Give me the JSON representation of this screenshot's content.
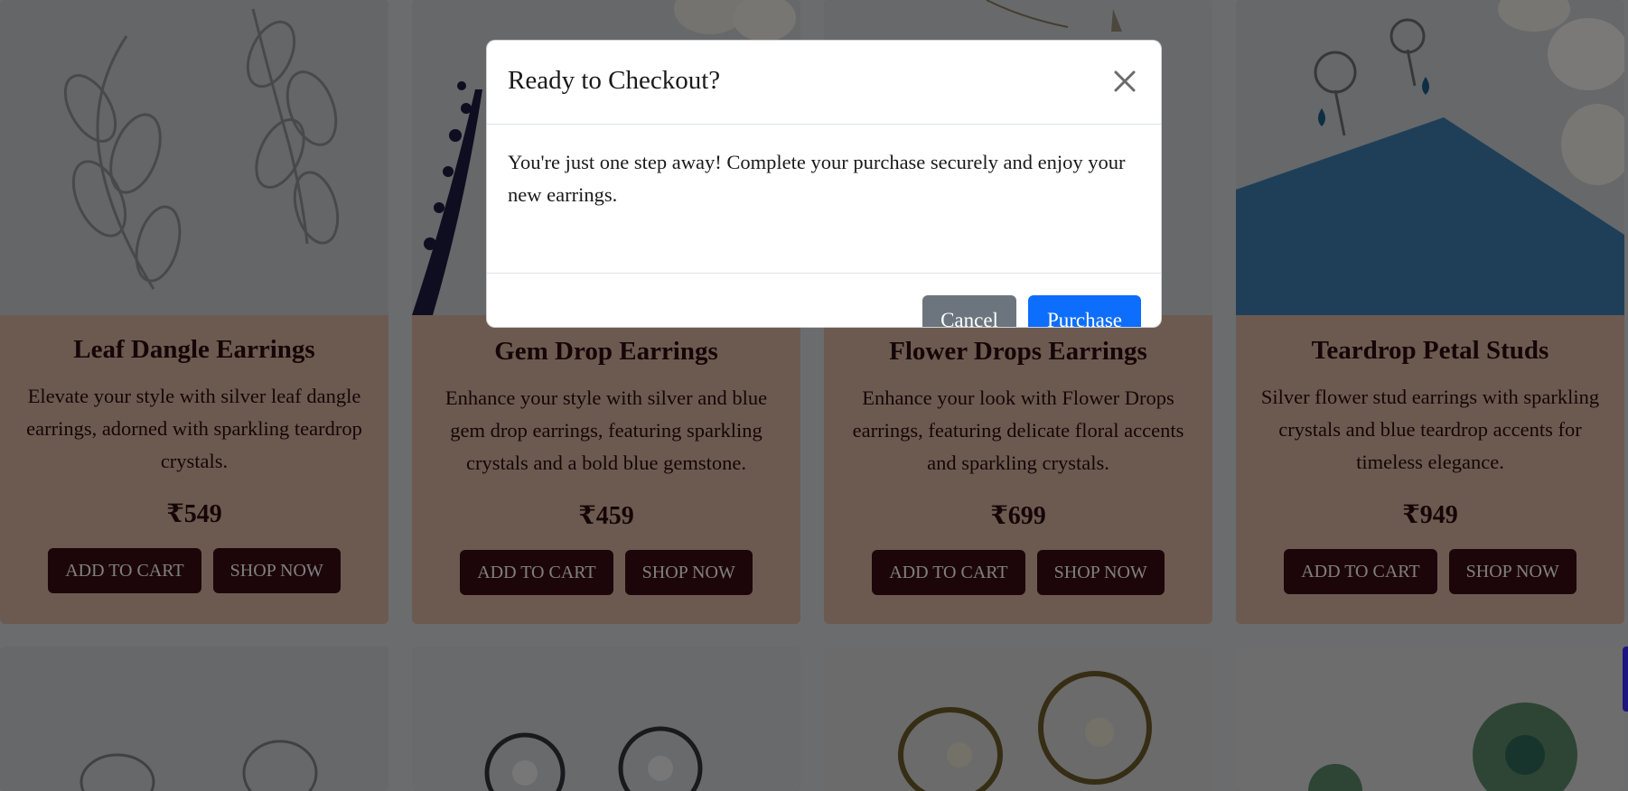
{
  "products": [
    {
      "title": "Leaf Dangle Earrings",
      "description": "Elevate your style with silver leaf dangle earrings, adorned with sparkling teardrop crystals.",
      "price": "₹549",
      "add_to_cart_label": "ADD TO CART",
      "shop_now_label": "SHOP NOW"
    },
    {
      "title": "Gem Drop Earrings",
      "description": "Enhance your style with silver and blue gem drop earrings, featuring sparkling crystals and a bold blue gemstone.",
      "price": "₹459",
      "add_to_cart_label": "ADD TO CART",
      "shop_now_label": "SHOP NOW"
    },
    {
      "title": "Flower Drops Earrings",
      "description": "Enhance your look with Flower Drops earrings, featuring delicate floral accents and sparkling crystals.",
      "price": "₹699",
      "add_to_cart_label": "ADD TO CART",
      "shop_now_label": "SHOP NOW"
    },
    {
      "title": "Teardrop Petal Studs",
      "description": "Silver flower stud earrings with sparkling crystals and blue teardrop accents for timeless elegance.",
      "price": "₹949",
      "add_to_cart_label": "ADD TO CART",
      "shop_now_label": "SHOP NOW"
    }
  ],
  "modal": {
    "title": "Ready to Checkout?",
    "message": "You're just one step away! Complete your purchase securely and enjoy your new earrings.",
    "cancel_label": "Cancel",
    "purchase_label": "Purchase",
    "close_icon": "close-icon"
  },
  "colors": {
    "card_body": "#d8b4a2",
    "button_dark": "#3a0c12",
    "purchase_button": "#0d6efd",
    "cancel_button": "#6c757d",
    "scroll_accent": "#3b2cff"
  }
}
